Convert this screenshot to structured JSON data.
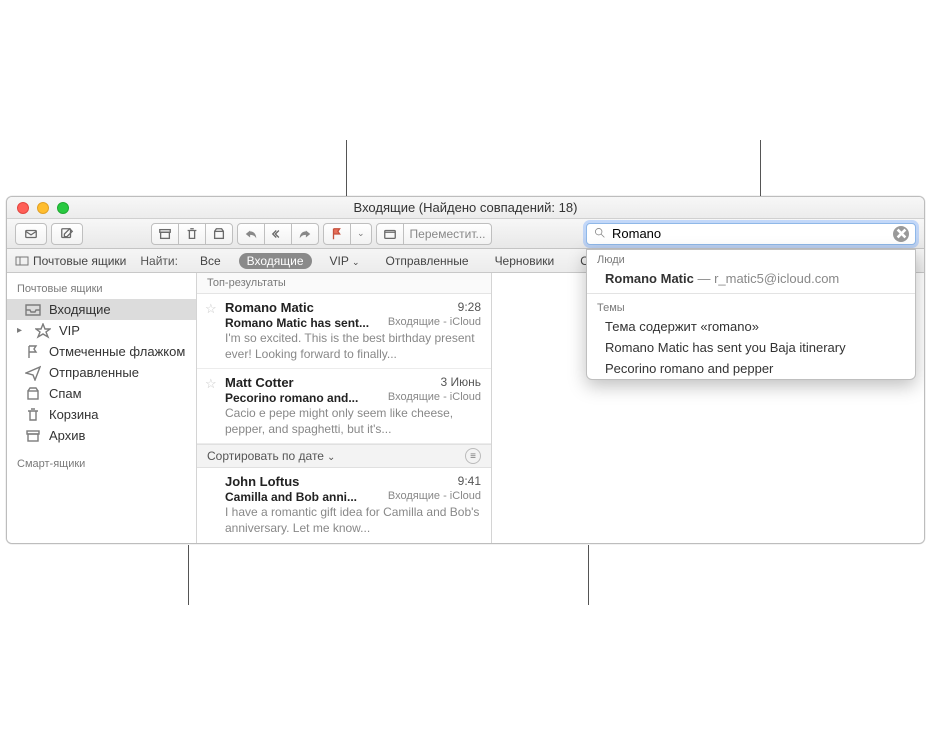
{
  "window": {
    "title": "Входящие (Найдено совпадений: 18)"
  },
  "toolbar": {
    "move_label": "Переместит..."
  },
  "search": {
    "value": "Romano"
  },
  "favorites": {
    "mailboxes_label": "Почтовые ящики",
    "find_label": "Найти:",
    "scopes": {
      "all": "Все",
      "inbox": "Входящие",
      "vip": "VIP",
      "sent": "Отправленные",
      "drafts": "Черновики",
      "flagged": "Отмеченные"
    }
  },
  "sidebar": {
    "section1": "Почтовые ящики",
    "inbox": "Входящие",
    "vip": "VIP",
    "flagged": "Отмеченные флажком",
    "sent": "Отправленные",
    "junk": "Спам",
    "trash": "Корзина",
    "archive": "Архив",
    "section2": "Смарт-ящики"
  },
  "list": {
    "top_header": "Топ-результаты",
    "sort_label": "Сортировать по дате",
    "items": [
      {
        "sender": "Romano Matic",
        "time": "9:28",
        "subject": "Romano Matic has sent...",
        "mailbox": "Входящие - iCloud",
        "preview": "I'm so excited. This is the best birthday present ever! Looking forward to finally..."
      },
      {
        "sender": "Matt Cotter",
        "time": "3 Июнь",
        "subject": "Pecorino romano and...",
        "mailbox": "Входящие - iCloud",
        "preview": "Cacio e pepe might only seem like cheese, pepper, and spaghetti, but it's..."
      },
      {
        "sender": "John Loftus",
        "time": "9:41",
        "subject": "Camilla and Bob anni...",
        "mailbox": "Входящие - iCloud",
        "preview": "I have a romantic gift idea for Camilla and Bob's anniversary. Let me know..."
      }
    ]
  },
  "dropdown": {
    "people_label": "Люди",
    "person_name": "Romano Matic",
    "person_email": " — r_matic5@icloud.com",
    "topics_label": "Темы",
    "topic1": "Тема содержит «romano»",
    "topic2": "Romano Matic has sent you Baja itinerary",
    "topic3": "Pecorino romano and pepper"
  }
}
